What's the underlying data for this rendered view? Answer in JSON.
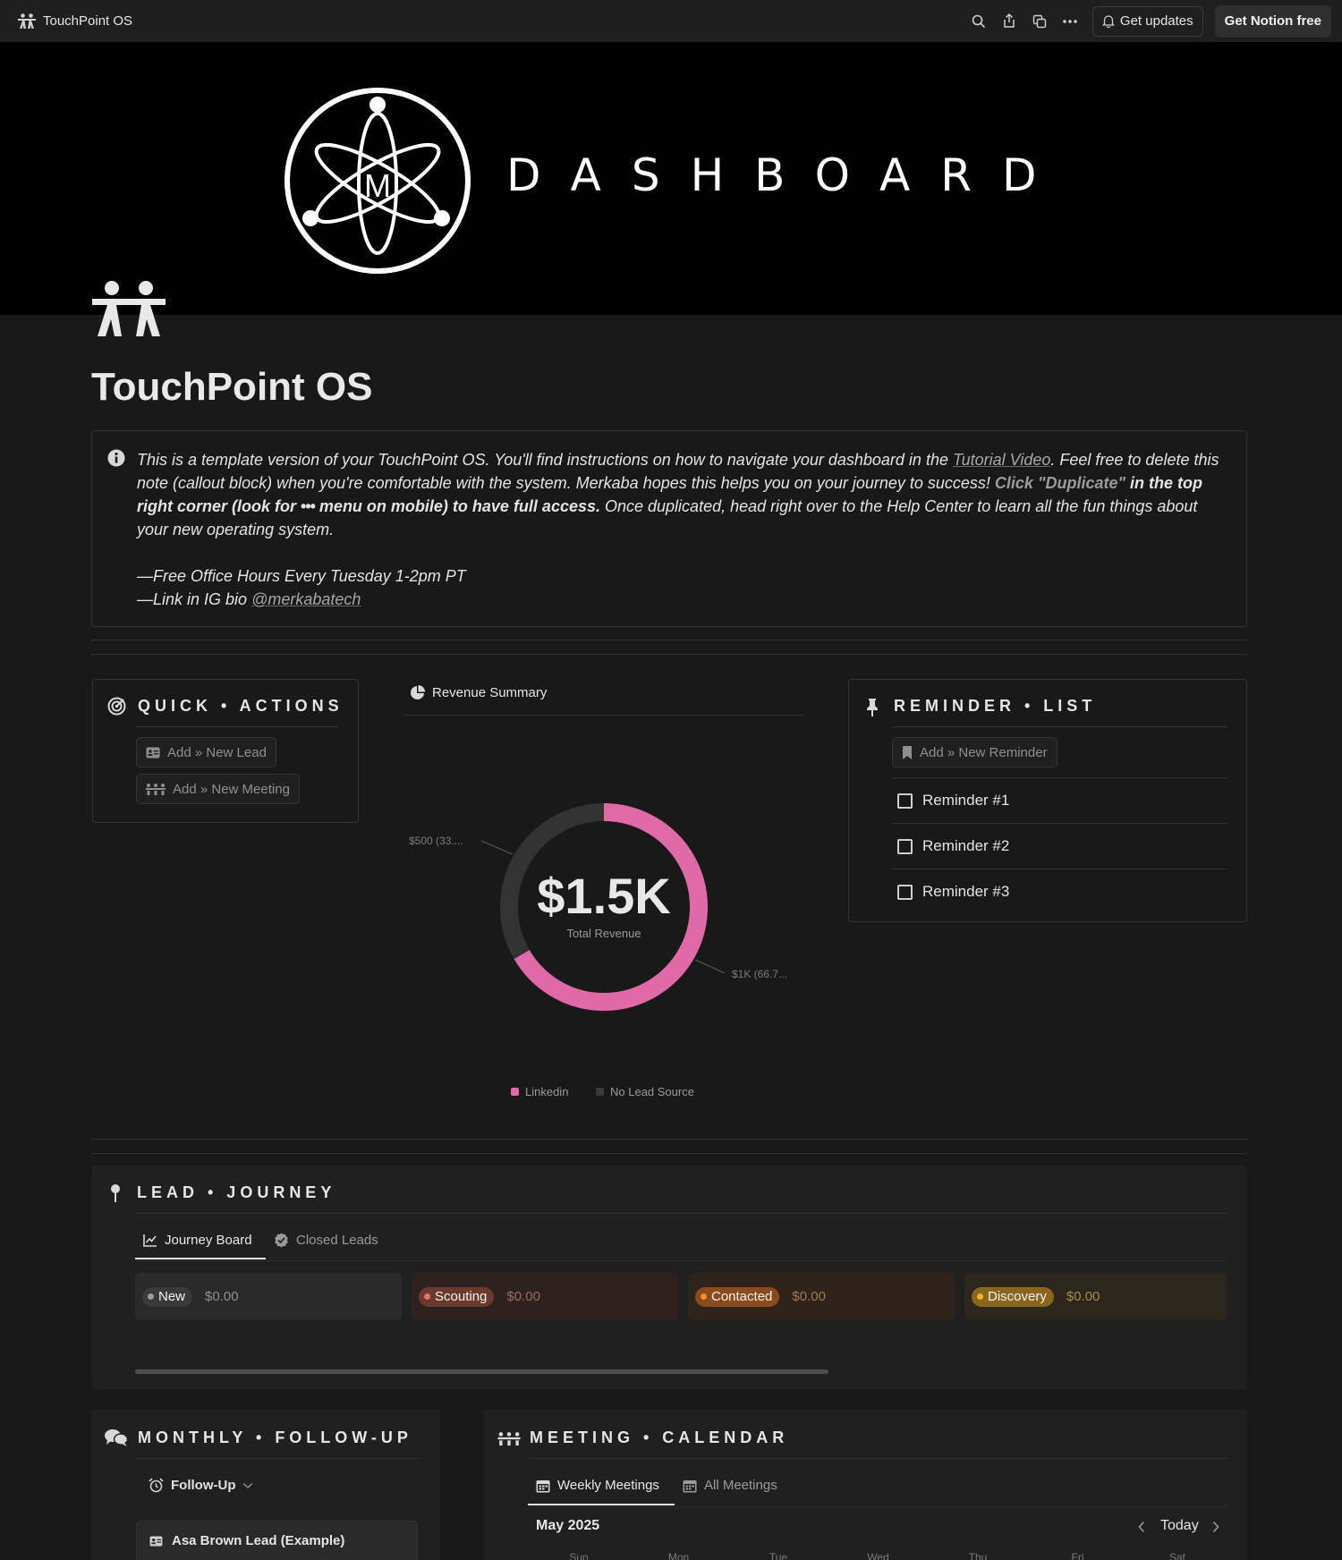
{
  "topbar": {
    "title": "TouchPoint OS",
    "get_updates": "Get updates",
    "get_notion": "Get Notion free"
  },
  "cover": {
    "word": "DASHBOARD",
    "logo_letter": "M"
  },
  "page": {
    "title": "TouchPoint OS"
  },
  "callout": {
    "p1_a": "This is a template version of your TouchPoint OS. You'll find instructions on how to navigate your dashboard in the ",
    "p1_link": "Tutorial Video",
    "p1_b": ". Feel free to delete this note (callout block) when you're comfortable with the system. Merkaba hopes this helps you on your journey to success! ",
    "p1_dup": "Click \"Duplicate\"",
    "p1_bold_a": " in the top right corner (look for ",
    "p1_dots": "•••",
    "p1_bold_b": " menu on mobile) to have full access.",
    "p1_c": " Once duplicated, head right over to the Help Center to learn all the fun things about your new operating system.",
    "line2": "—Free Office Hours Every Tuesday 1-2pm PT",
    "line3_a": "—Link in IG bio ",
    "line3_link": "@merkabatech"
  },
  "quick_actions": {
    "heading": "QUICK • ACTIONS",
    "new_lead": "Add » New Lead",
    "new_meeting": "Add » New Meeting"
  },
  "revenue": {
    "heading": "Revenue Summary",
    "total": "$1.5K",
    "total_label": "Total Revenue",
    "label_500": "$500 (33....",
    "label_1k": "$1K (66.7..."
  },
  "chart_data": {
    "type": "pie",
    "categories": [
      "Linkedin",
      "No Lead Source"
    ],
    "values": [
      1000,
      500
    ],
    "center_label": "Total Revenue",
    "colors": [
      "#e06aa8",
      "#333333"
    ]
  },
  "reminders": {
    "heading": "REMINDER • LIST",
    "add": "Add » New Reminder",
    "items": [
      "Reminder #1",
      "Reminder #2",
      "Reminder #3"
    ]
  },
  "lead_journey": {
    "heading": "LEAD • JOURNEY",
    "tabs": [
      "Journey Board",
      "Closed Leads"
    ],
    "columns": [
      {
        "label": "New",
        "amount": "$0.00",
        "pill": "#3a3a3a",
        "dot": "#9b9b9b",
        "bg": "#2a2a2a",
        "amt": "#8f8f8f"
      },
      {
        "label": "Scouting",
        "amount": "$0.00",
        "pill": "#6b3a2c",
        "dot": "#e07a5f",
        "bg": "#2d2220",
        "amt": "#9a6b5e"
      },
      {
        "label": "Contacted",
        "amount": "$0.00",
        "pill": "#8a4a1c",
        "dot": "#f28c28",
        "bg": "#2e241c",
        "amt": "#a5764e"
      },
      {
        "label": "Discovery",
        "amount": "$0.00",
        "pill": "#89651d",
        "dot": "#f0b429",
        "bg": "#2c261b",
        "amt": "#a88a4f"
      }
    ]
  },
  "follow_up": {
    "heading": "MONTHLY • FOLLOW-UP",
    "view": "Follow-Up",
    "card": "Asa Brown Lead (Example)"
  },
  "meeting_calendar": {
    "heading": "MEETING • CALENDAR",
    "tabs": [
      "Weekly Meetings",
      "All Meetings"
    ],
    "month": "May 2025",
    "today": "Today",
    "weekdays": [
      "Sun",
      "Mon",
      "Tue",
      "Wed",
      "Thu",
      "Fri",
      "Sat"
    ]
  }
}
